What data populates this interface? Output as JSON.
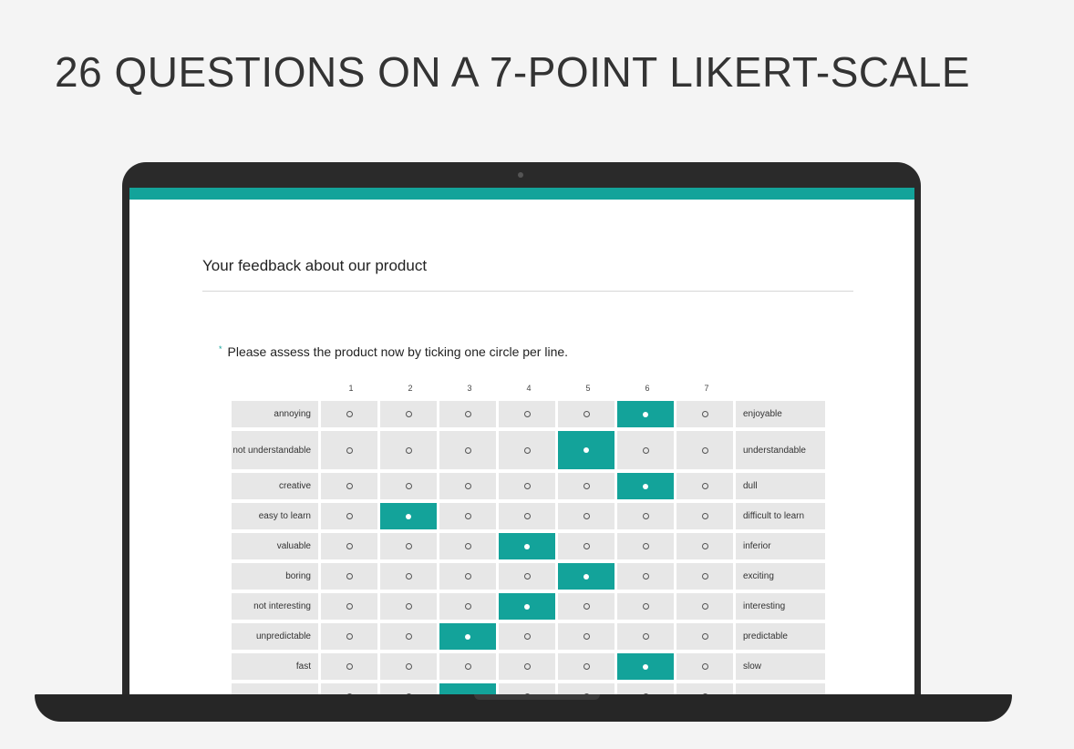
{
  "headline": "26 QUESTIONS ON A 7-POINT LIKERT-SCALE",
  "form": {
    "title": "Your feedback about our product",
    "question_marker": "*",
    "question": "Please assess the product now by ticking one circle per line.",
    "scale": [
      "1",
      "2",
      "3",
      "4",
      "5",
      "6",
      "7"
    ],
    "items": [
      {
        "left": "annoying",
        "right": "enjoyable",
        "selected": 6,
        "tall": false
      },
      {
        "left": "not understandable",
        "right": "understandable",
        "selected": 5,
        "tall": true
      },
      {
        "left": "creative",
        "right": "dull",
        "selected": 6,
        "tall": false
      },
      {
        "left": "easy to learn",
        "right": "difficult to learn",
        "selected": 2,
        "tall": false
      },
      {
        "left": "valuable",
        "right": "inferior",
        "selected": 4,
        "tall": false
      },
      {
        "left": "boring",
        "right": "exciting",
        "selected": 5,
        "tall": false
      },
      {
        "left": "not interesting",
        "right": "interesting",
        "selected": 4,
        "tall": false
      },
      {
        "left": "unpredictable",
        "right": "predictable",
        "selected": 3,
        "tall": false
      },
      {
        "left": "fast",
        "right": "slow",
        "selected": 6,
        "tall": false
      },
      {
        "left": "",
        "right": "",
        "selected": 3,
        "tall": false
      }
    ]
  },
  "colors": {
    "accent": "#13a39a",
    "cell_bg": "#e7e7e7",
    "laptop": "#2a2a2a"
  }
}
